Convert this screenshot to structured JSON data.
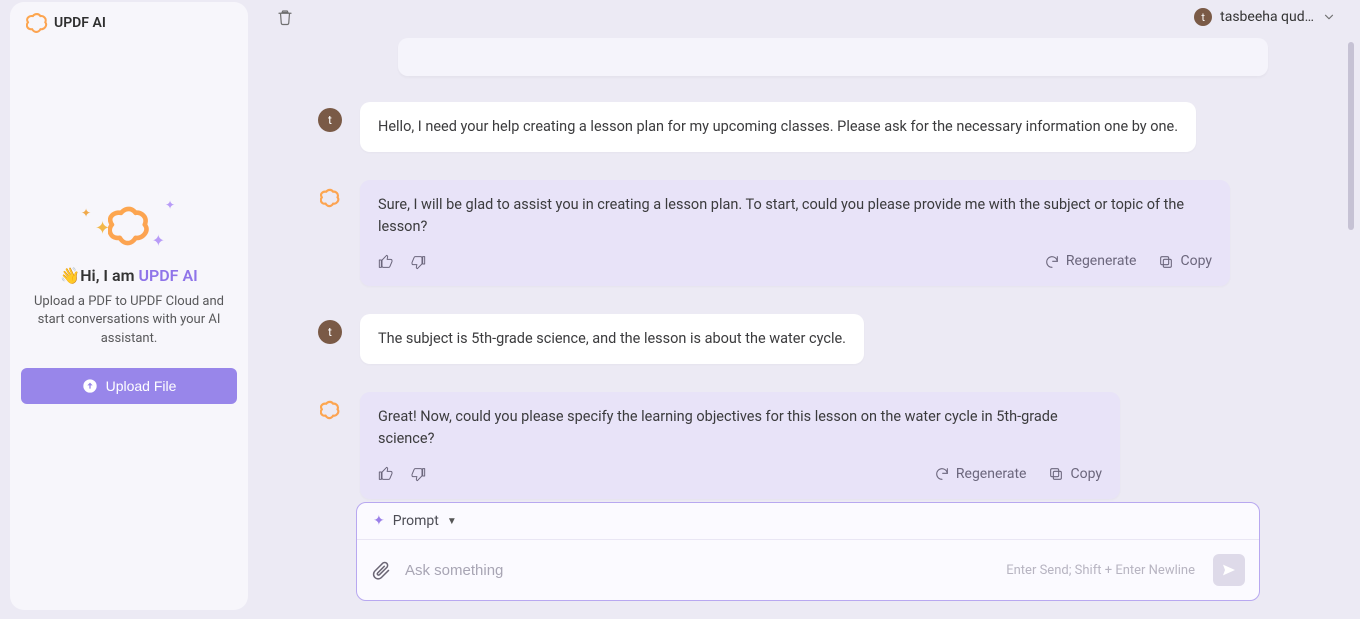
{
  "app": {
    "name": "UPDF AI"
  },
  "sidebar": {
    "greeting_prefix": "👋Hi, I am ",
    "greeting_brand": "UPDF AI",
    "description": "Upload a PDF to UPDF Cloud and start conversations with your AI assistant.",
    "upload_label": "Upload File"
  },
  "header": {
    "user_initial": "t",
    "user_display": "tasbeeha qud…"
  },
  "conversation": {
    "user_initial": "t",
    "messages": [
      {
        "role": "user",
        "text": "Hello, I need your help creating a lesson plan for my upcoming classes. Please ask for the necessary information one by one."
      },
      {
        "role": "ai",
        "text": "Sure, I will be glad to assist you in creating a lesson plan. To start, could you please provide me with the subject or topic of the lesson?"
      },
      {
        "role": "user",
        "text": "The subject is 5th-grade science, and the lesson is about the water cycle."
      },
      {
        "role": "ai",
        "text": "Great! Now, could you please specify the learning objectives for this lesson on the water cycle in 5th-grade science?"
      }
    ]
  },
  "actions": {
    "regenerate": "Regenerate",
    "copy": "Copy"
  },
  "composer": {
    "prompt_label": "Prompt",
    "placeholder": "Ask something",
    "hint": "Enter Send; Shift + Enter Newline"
  }
}
